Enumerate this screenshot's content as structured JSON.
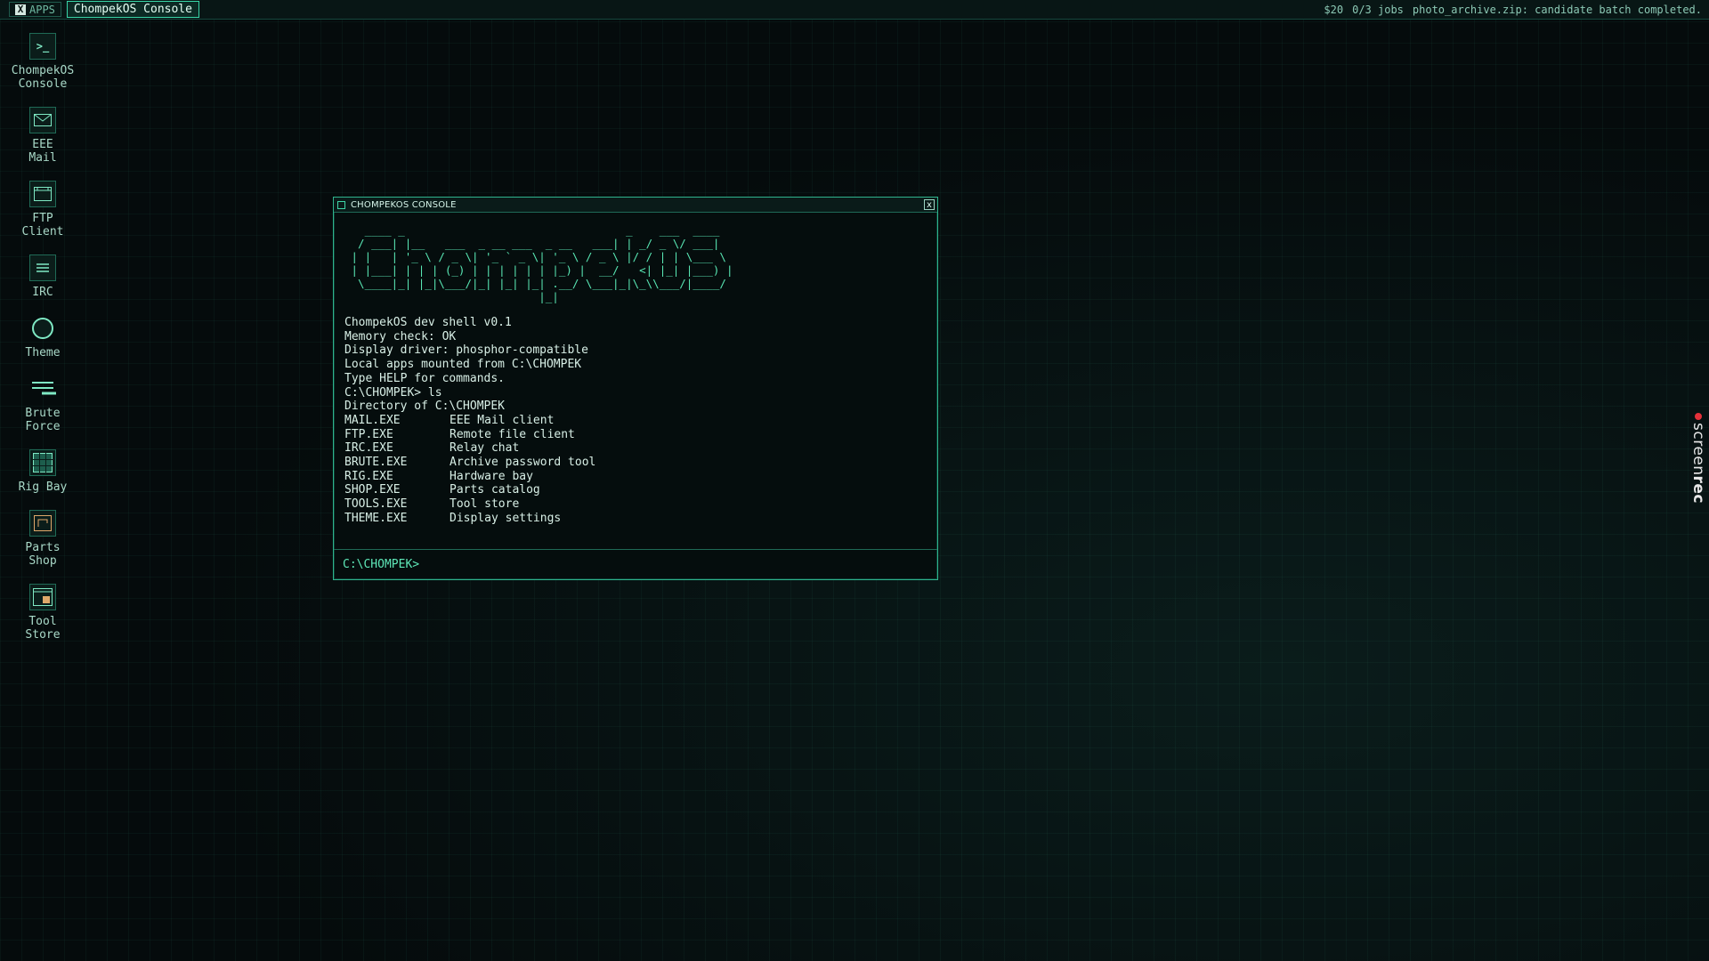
{
  "topbar": {
    "apps_icon": "x-icon",
    "apps_mark": "X",
    "apps_label": "APPS",
    "active_task": "ChompekOS Console",
    "status": {
      "money": "$20",
      "jobs": "0/3 jobs",
      "notification": "photo_archive.zip: candidate batch completed."
    }
  },
  "desktop": {
    "icons": [
      {
        "label": "ChompekOS\nConsole",
        "icon": "terminal-icon"
      },
      {
        "label": "EEE\nMail",
        "icon": "mail-icon"
      },
      {
        "label": "FTP\nClient",
        "icon": "folder-window-icon"
      },
      {
        "label": "IRC",
        "icon": "chat-lines-icon"
      },
      {
        "label": "Theme",
        "icon": "circle-icon"
      },
      {
        "label": "Brute\nForce",
        "icon": "brute-force-icon"
      },
      {
        "label": "Rig Bay",
        "icon": "grid-icon"
      },
      {
        "label": "Parts\nShop",
        "icon": "shop-icon"
      },
      {
        "label": "Tool\nStore",
        "icon": "tool-store-icon"
      }
    ]
  },
  "console": {
    "title": "CHOMPEKOS CONSOLE",
    "close_label": "x",
    "ascii_banner": "   ____ _                                 _    ___  ____  \n  / ___| |__   ___  _ __ ___  _ __   ___| | _/ _ \\/ ___| \n | |   | '_ \\ / _ \\| '_ ` _ \\| '_ \\ / _ \\ |/ / | | \\___ \\ \n | |___| | | | (_) | | | | | | |_) |  __/   <| |_| |___) |\n  \\____|_| |_|\\___/|_| |_| |_| .__/ \\___|_|\\_\\\\___/|____/ \n                             |_|                          ",
    "lines": [
      "ChompekOS dev shell v0.1",
      "Memory check: OK",
      "Display driver: phosphor-compatible",
      "Local apps mounted from C:\\CHOMPEK",
      "Type HELP for commands.",
      "C:\\CHOMPEK> ls",
      "Directory of C:\\CHOMPEK"
    ],
    "directory": [
      {
        "name": "MAIL.EXE",
        "desc": "EEE Mail client"
      },
      {
        "name": "FTP.EXE",
        "desc": "Remote file client"
      },
      {
        "name": "IRC.EXE",
        "desc": "Relay chat"
      },
      {
        "name": "BRUTE.EXE",
        "desc": "Archive password tool"
      },
      {
        "name": "RIG.EXE",
        "desc": "Hardware bay"
      },
      {
        "name": "SHOP.EXE",
        "desc": "Parts catalog"
      },
      {
        "name": "TOOLS.EXE",
        "desc": "Tool store"
      },
      {
        "name": "THEME.EXE",
        "desc": "Display settings"
      }
    ],
    "prompt": "C:\\CHOMPEK>",
    "input_value": ""
  },
  "watermark": {
    "text_light": "screen",
    "text_bold": "rec"
  },
  "colors": {
    "accent": "#38d6a8",
    "banner": "#59e7b4",
    "background": "#050b0c",
    "record_dot": "#e4313a"
  }
}
